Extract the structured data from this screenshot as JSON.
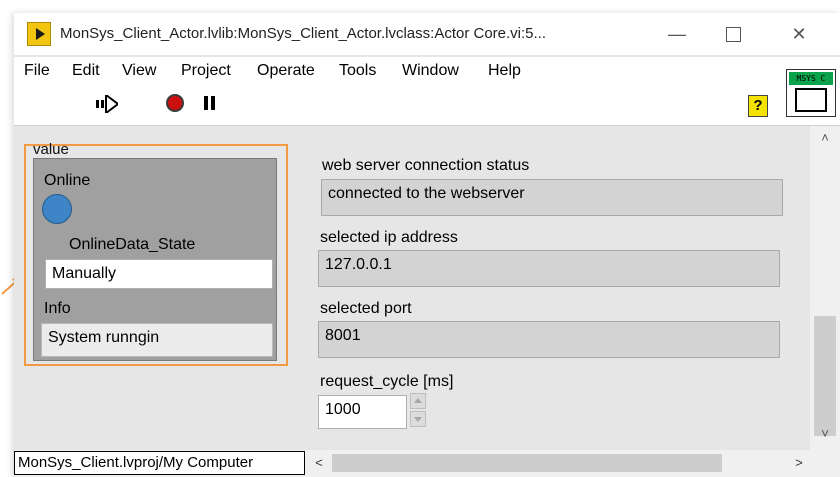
{
  "window": {
    "title": "MonSys_Client_Actor.lvlib:MonSys_Client_Actor.lvclass:Actor Core.vi:5..."
  },
  "menu": [
    "File",
    "Edit",
    "View",
    "Project",
    "Operate",
    "Tools",
    "Window",
    "Help"
  ],
  "toolbar": {
    "badge": "MSYS C",
    "help_glyph": "?"
  },
  "cluster": {
    "caption": "value",
    "online_label": "Online",
    "online_state_label": "OnlineData_State",
    "online_state_value": "Manually",
    "info_label": "Info",
    "info_value": "System runngin"
  },
  "indicators": {
    "webserver_label": "web server connection status",
    "webserver_value": "connected to the webserver",
    "ip_label": "selected ip address",
    "ip_value": "127.0.0.1",
    "port_label": "selected port",
    "port_value": "8001",
    "cycle_label": "request_cycle [ms]",
    "cycle_value": "1000"
  },
  "status": {
    "project_path": "MonSys_Client.lvproj/My Computer"
  },
  "colors": {
    "highlight": "#f39a43",
    "led_on": "#3d85c6",
    "badge_bg": "#0aa24b"
  }
}
